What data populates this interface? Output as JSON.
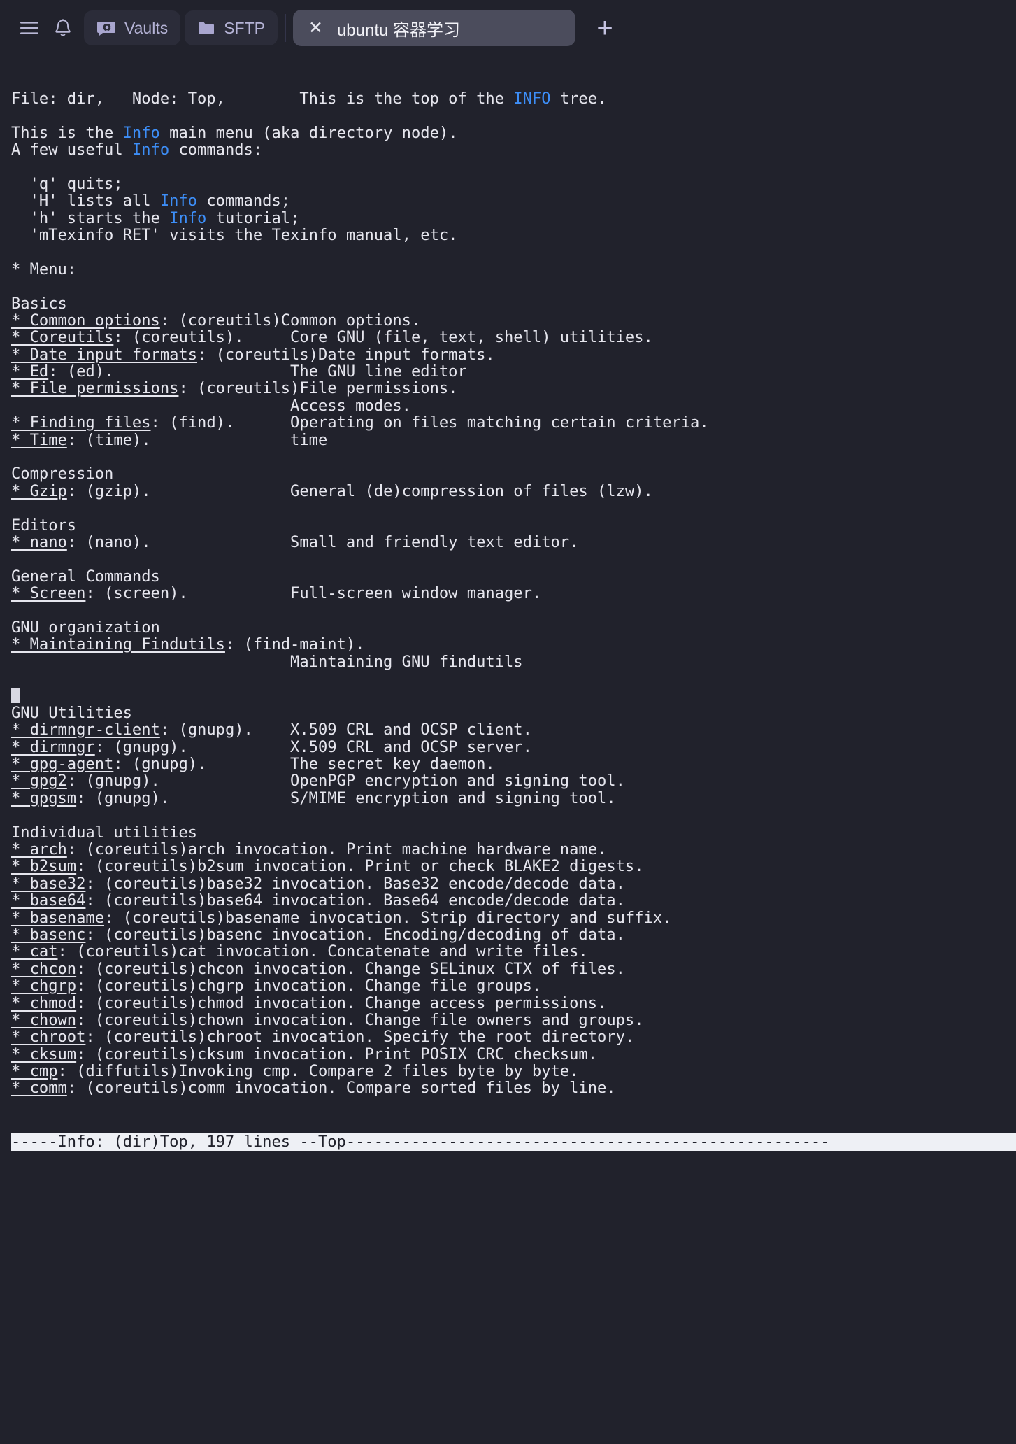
{
  "topbar": {
    "menu_icon": "hamburger-menu-icon",
    "bell_icon": "bell-icon",
    "vaults": {
      "label": "Vaults",
      "icon": "vault-icon"
    },
    "sftp": {
      "label": "SFTP",
      "icon": "folder-icon"
    },
    "terminal_tab": {
      "close_label": "✕",
      "title": "ubuntu 容器学习"
    },
    "new_tab_label": "+"
  },
  "colors": {
    "terminal_bg": "#21222c",
    "terminal_fg": "#e6e6ee",
    "link_blue": "#3d8ef7",
    "statusbar_bg": "#eef0f5",
    "statusbar_fg": "#21222c",
    "chip_bg": "#2b2c39",
    "active_tab_bg": "#4b4c5c"
  },
  "terminal": {
    "header": {
      "file": "File: dir,",
      "node": "Node: Top,",
      "top_note_pre": "This is the top of the ",
      "top_note_kw": "INFO",
      "top_note_post": " tree."
    },
    "intro": [
      {
        "pre": "This is the ",
        "kw": "Info",
        "post": " main menu (aka directory node)."
      },
      {
        "pre": "A few useful ",
        "kw": "Info",
        "post": " commands:"
      }
    ],
    "commands": [
      {
        "pre": "  'q' quits;",
        "kw": "",
        "post": ""
      },
      {
        "pre": "  'H' lists all ",
        "kw": "Info",
        "post": " commands;"
      },
      {
        "pre": "  'h' starts the ",
        "kw": "Info",
        "post": " tutorial;"
      },
      {
        "pre": "  'mTexinfo RET' visits the Texinfo manual, etc.",
        "kw": "",
        "post": ""
      }
    ],
    "menu_label": "* Menu:",
    "sections": [
      {
        "heading": "Basics",
        "entries": [
          {
            "link": "* Common options",
            "rest": ": (coreutils)Common options.",
            "desc": ""
          },
          {
            "link": "* Coreutils",
            "rest": ": (coreutils).",
            "desc": "Core GNU (file, text, shell) utilities."
          },
          {
            "link": "* Date input formats",
            "rest": ": (coreutils)Date input formats.",
            "desc": ""
          },
          {
            "link": "* Ed",
            "rest": ": (ed).",
            "desc": "The GNU line editor"
          },
          {
            "link": "* File permissions",
            "rest": ": (coreutils)File permissions.",
            "desc": ""
          },
          {
            "link": "",
            "rest": "",
            "desc": "Access modes."
          },
          {
            "link": "* Finding files",
            "rest": ": (find).",
            "desc": "Operating on files matching certain criteria."
          },
          {
            "link": "* Time",
            "rest": ": (time).",
            "desc": "time"
          }
        ]
      },
      {
        "heading": "Compression",
        "entries": [
          {
            "link": "* Gzip",
            "rest": ": (gzip).",
            "desc": "General (de)compression of files (lzw)."
          }
        ]
      },
      {
        "heading": "Editors",
        "entries": [
          {
            "link": "* nano",
            "rest": ": (nano).",
            "desc": "Small and friendly text editor."
          }
        ]
      },
      {
        "heading": "General Commands",
        "entries": [
          {
            "link": "* Screen",
            "rest": ": (screen).",
            "desc": "Full-screen window manager."
          }
        ]
      },
      {
        "heading": "GNU organization",
        "entries": [
          {
            "link": "* Maintaining Findutils",
            "rest": ": (find-maint).",
            "desc": ""
          },
          {
            "link": "",
            "rest": "",
            "desc": "Maintaining GNU findutils"
          }
        ]
      },
      {
        "heading": "GNU Utilities",
        "cursor_before": true,
        "entries": [
          {
            "link": "* dirmngr-client",
            "rest": ": (gnupg).",
            "desc": "X.509 CRL and OCSP client."
          },
          {
            "link": "* dirmngr",
            "rest": ": (gnupg).",
            "desc": "X.509 CRL and OCSP server."
          },
          {
            "link": "* gpg-agent",
            "rest": ": (gnupg).",
            "desc": "The secret key daemon."
          },
          {
            "link": "* gpg2",
            "rest": ": (gnupg).",
            "desc": "OpenPGP encryption and signing tool."
          },
          {
            "link": "* gpgsm",
            "rest": ": (gnupg).",
            "desc": "S/MIME encryption and signing tool."
          }
        ]
      },
      {
        "heading": "Individual utilities",
        "entries": [
          {
            "link": "* arch",
            "rest": ": (coreutils)arch invocation.",
            "desc": "Print machine hardware name."
          },
          {
            "link": "* b2sum",
            "rest": ": (coreutils)b2sum invocation.",
            "desc": "Print or check BLAKE2 digests."
          },
          {
            "link": "* base32",
            "rest": ": (coreutils)base32 invocation.",
            "desc": "Base32 encode/decode data."
          },
          {
            "link": "* base64",
            "rest": ": (coreutils)base64 invocation.",
            "desc": "Base64 encode/decode data."
          },
          {
            "link": "* basename",
            "rest": ": (coreutils)basename invocation.",
            "desc": "Strip directory and suffix."
          },
          {
            "link": "* basenc",
            "rest": ": (coreutils)basenc invocation.",
            "desc": "Encoding/decoding of data."
          },
          {
            "link": "* cat",
            "rest": ": (coreutils)cat invocation.",
            "desc": "Concatenate and write files."
          },
          {
            "link": "* chcon",
            "rest": ": (coreutils)chcon invocation.",
            "desc": "Change SELinux CTX of files."
          },
          {
            "link": "* chgrp",
            "rest": ": (coreutils)chgrp invocation.",
            "desc": "Change file groups."
          },
          {
            "link": "* chmod",
            "rest": ": (coreutils)chmod invocation.",
            "desc": "Change access permissions."
          },
          {
            "link": "* chown",
            "rest": ": (coreutils)chown invocation.",
            "desc": "Change file owners and groups."
          },
          {
            "link": "* chroot",
            "rest": ": (coreutils)chroot invocation.",
            "desc": "Specify the root directory."
          },
          {
            "link": "* cksum",
            "rest": ": (coreutils)cksum invocation.",
            "desc": "Print POSIX CRC checksum."
          },
          {
            "link": "* cmp",
            "rest": ": (diffutils)Invoking cmp.",
            "desc": "Compare 2 files byte by byte."
          },
          {
            "link": "* comm",
            "rest": ": (coreutils)comm invocation.",
            "desc": "Compare sorted files by line."
          }
        ]
      }
    ],
    "statusline": "-----Info: (dir)Top, 197 lines --Top----------------------------------------------------"
  }
}
